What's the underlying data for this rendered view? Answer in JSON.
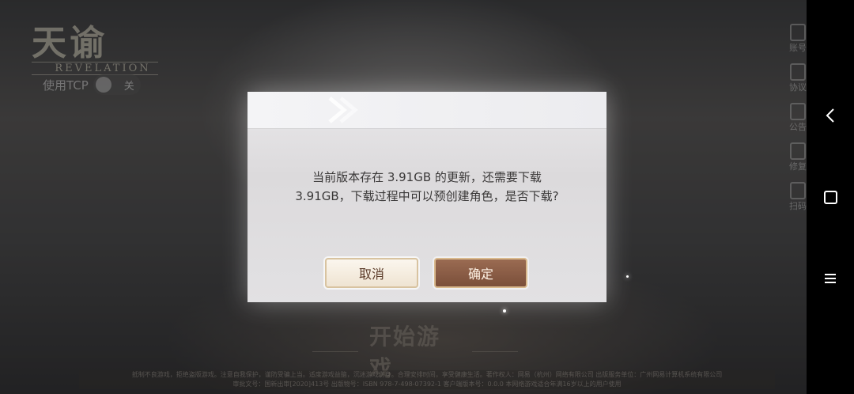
{
  "game": {
    "logo_main": "天谕",
    "logo_sub": "REVELATION",
    "tcp_label": "使用TCP",
    "tcp_toggle_text": "关",
    "start_button": "开始游戏",
    "footer_line1": "抵制不良游戏，拒绝盗版游戏。注意自我保护，谨防受骗上当。适度游戏益脑，沉迷游戏伤身。合理安排时间，享受健康生活。著作权人：网易（杭州）网络有限公司 出版服务单位：广州网易计算机系统有限公司",
    "footer_line2": "审批文号：国新出审[2020]413号 出版物号：ISBN 978-7-498-07392-1 客户端版本号：0.0.0 本网络游戏适合年满16岁以上的用户使用"
  },
  "side_menu": [
    {
      "label": "账号",
      "icon": "account-icon"
    },
    {
      "label": "协议",
      "icon": "agreement-icon"
    },
    {
      "label": "公告",
      "icon": "notice-icon"
    },
    {
      "label": "修复",
      "icon": "repair-icon"
    },
    {
      "label": "扫码",
      "icon": "qrcode-icon"
    }
  ],
  "dialog": {
    "message_line1": "当前版本存在 3.91GB 的更新，还需要下载",
    "message_line2": "3.91GB，下载过程中可以预创建角色，是否下载?",
    "cancel_label": "取消",
    "confirm_label": "确定"
  },
  "nav": {
    "back_icon": "chevron-left-icon",
    "home_icon": "square-icon",
    "menu_icon": "menu-icon"
  },
  "colors": {
    "confirm_bg": "#7b4f3a",
    "cancel_bg": "#efe4d2",
    "dialog_bg": "#e2e1e3"
  }
}
